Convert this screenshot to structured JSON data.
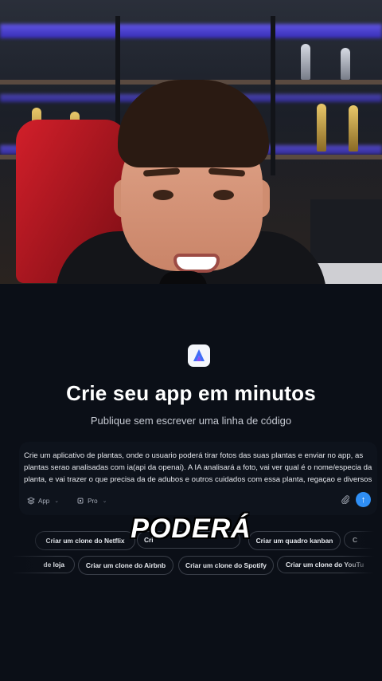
{
  "app": {
    "title": "Crie seu app em minutos",
    "subtitle": "Publique sem escrever uma linha de código"
  },
  "prompt": {
    "text": "Crie um aplicativo de plantas, onde o usuario poderá tirar fotos das suas plantas e enviar no app, as plantas serao analisadas com ia(api da openai). A IA analisará a foto, vai ver qual é o nome/especia da planta, e vai trazer o que precisa da de adubos e outros cuidados com essa planta, regaçao e diversos",
    "mode_label": "App",
    "model_label": "Pro"
  },
  "suggestions": {
    "row1": [
      "Criar um clone do Netflix",
      "Cri",
      "Criar um quadro kanban",
      "C"
    ],
    "row2": [
      "de loja",
      "Criar um clone do Airbnb",
      "Criar um clone do Spotify",
      "Criar um clone do YouTu"
    ]
  },
  "caption": "PODERÁ",
  "colors": {
    "background": "#0b0f17",
    "send_button": "#2f8ff5"
  },
  "icons": [
    "app-logo-icon",
    "layers-icon",
    "chip-icon",
    "chevron-down-icon",
    "paperclip-icon",
    "arrow-up-icon"
  ]
}
